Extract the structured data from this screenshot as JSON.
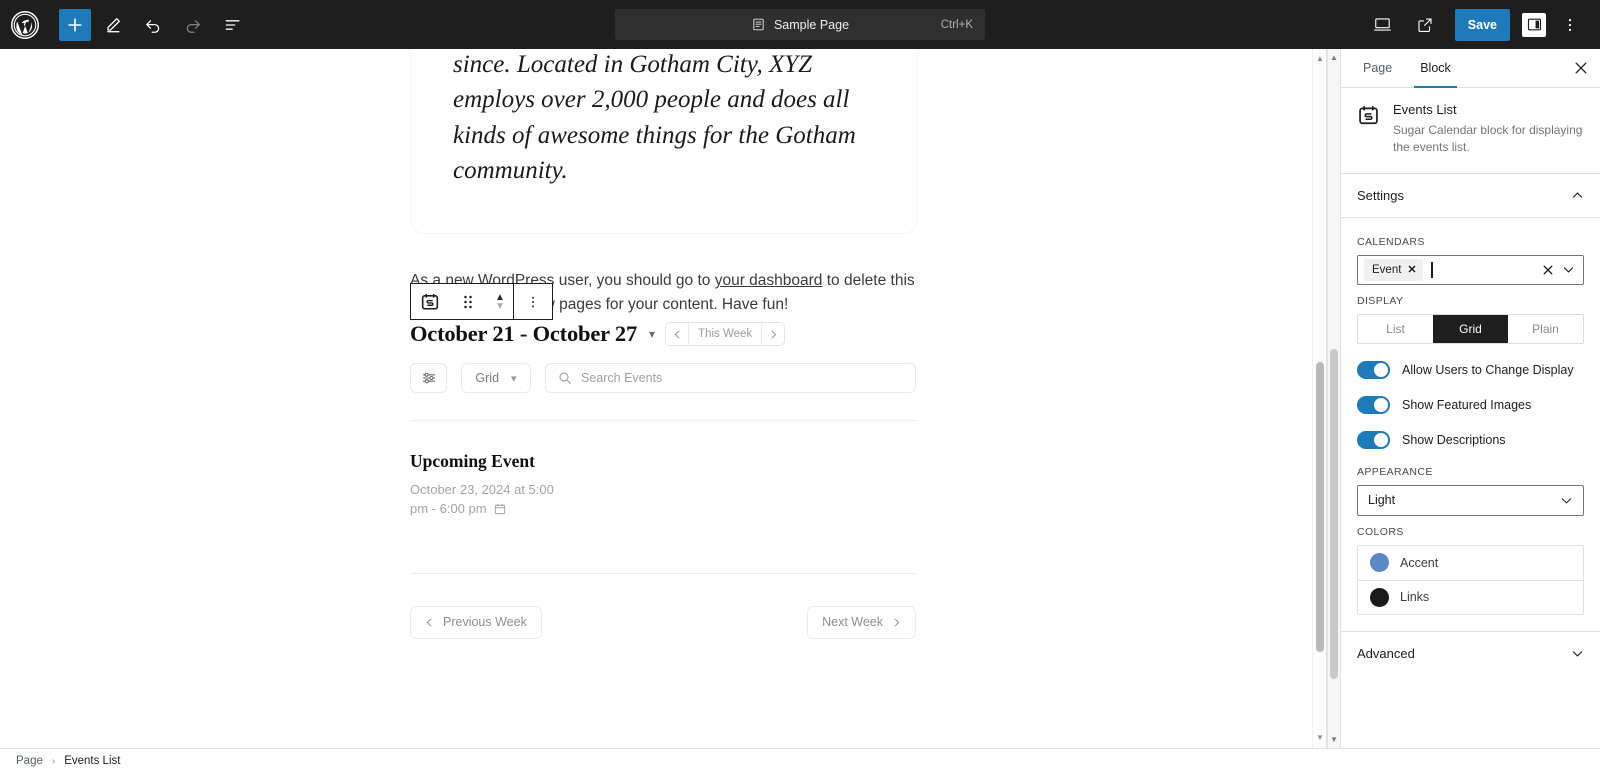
{
  "topbar": {
    "logo_icon": "wordpress-logo-icon",
    "add_block_label": "+",
    "tools": [
      {
        "name": "add-block-button",
        "icon": "plus-icon"
      },
      {
        "name": "edit-mode-button",
        "icon": "pencil-icon"
      },
      {
        "name": "undo-button",
        "icon": "undo-arrow-icon"
      },
      {
        "name": "redo-button",
        "icon": "redo-arrow-icon"
      },
      {
        "name": "document-overview-button",
        "icon": "list-view-icon"
      }
    ],
    "doc_switcher": {
      "icon": "page-icon",
      "title": "Sample Page",
      "shortcut": "Ctrl+K"
    },
    "view_icon": "desktop-preview-icon",
    "external_icon": "view-site-external-icon",
    "save_label": "Save",
    "settings_icon": "settings-sidebar-icon",
    "options_icon": "three-dots-vertical-icon"
  },
  "canvas": {
    "intro_card": {
      "text": "quality doohickeys to the public ever since. Located in Gotham City, XYZ employs over 2,000 people and does all kinds of awesome things for the Gotham community."
    },
    "paragraph": {
      "before_link": "As a new WordPress user, you should go to ",
      "link": "your dashboard",
      "after_link": " to delete this page and create new pages for your content. Have fun!"
    },
    "block_toolbar": {
      "block_icon": "events-list-block-icon",
      "drag_icon": "drag-handle-icon",
      "move_up_icon": "chevron-up-icon",
      "move_down_icon": "chevron-down-icon",
      "options_icon": "three-dots-vertical-icon"
    },
    "events_block": {
      "date_range": "October 21 - October 27",
      "range_caret_icon": "chevron-down-icon",
      "week_nav": {
        "prev_icon": "chevron-left-icon",
        "label": "This Week",
        "next_icon": "chevron-right-icon"
      },
      "filter_icon": "filter-sliders-icon",
      "display_select": {
        "value": "Grid",
        "caret_icon": "chevron-down-icon"
      },
      "search": {
        "icon": "search-icon",
        "placeholder": "Search Events"
      },
      "event": {
        "title": "Upcoming Event",
        "datetime": "October 23, 2024 at 5:00 pm - 6:00 pm",
        "calendar_icon": "calendar-icon"
      },
      "footer": {
        "prev_icon": "chevron-left-icon",
        "prev_label": "Previous Week",
        "next_label": "Next Week",
        "next_icon": "chevron-right-icon"
      }
    }
  },
  "sidebar": {
    "tabs": [
      {
        "label": "Page",
        "active": false
      },
      {
        "label": "Block",
        "active": true
      }
    ],
    "close_icon": "close-icon",
    "block": {
      "icon": "events-list-block-icon",
      "name": "Events List",
      "description": "Sugar Calendar block for displaying the events list."
    },
    "settings": {
      "title": "Settings",
      "collapse_icon": "chevron-up-icon",
      "calendars_label": "CALENDARS",
      "calendars_token": "Event",
      "token_remove_icon": "close-small-icon",
      "clear_icon": "clear-x-icon",
      "expand_icon": "chevron-down-icon",
      "display_label": "DISPLAY",
      "display_options": [
        {
          "label": "List",
          "active": false
        },
        {
          "label": "Grid",
          "active": true
        },
        {
          "label": "Plain",
          "active": false
        }
      ],
      "toggles": [
        {
          "label": "Allow Users to Change Display",
          "on": true
        },
        {
          "label": "Show Featured Images",
          "on": true
        },
        {
          "label": "Show Descriptions",
          "on": true
        }
      ],
      "appearance_label": "APPEARANCE",
      "appearance_value": "Light",
      "appearance_caret_icon": "chevron-down-icon",
      "colors_label": "COLORS",
      "colors": [
        {
          "name": "Accent",
          "hex": "#5a87c5"
        },
        {
          "name": "Links",
          "hex": "#1a1a1a"
        }
      ]
    },
    "advanced": {
      "title": "Advanced",
      "expand_icon": "chevron-down-icon"
    }
  },
  "footbar": {
    "crumbs": [
      {
        "label": "Page"
      },
      {
        "label": "Events List"
      }
    ],
    "separator": "›"
  },
  "colors": {
    "accent_blue": "#1e7ab9",
    "dark": "#1e1e1e",
    "border": "#e0e0e0"
  }
}
